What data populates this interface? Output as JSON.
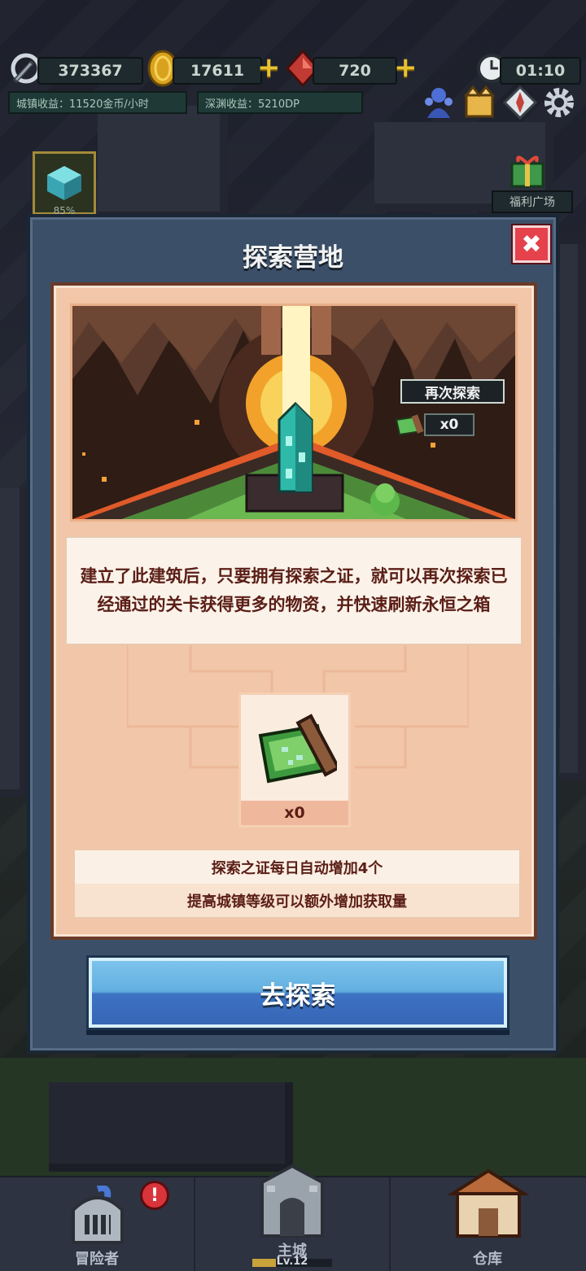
{
  "hud": {
    "power": "373367",
    "gold": "17611",
    "gems": "720",
    "timer": "01:10",
    "town_income": "城镇收益：11520金币/小时",
    "abyss_income": "深渊收益：5210DP",
    "welfare_label": "福利广场",
    "build_progress": "85%"
  },
  "modal": {
    "title": "探索营地",
    "close_glyph": "✖",
    "scene": {
      "reexplore_label": "再次探索",
      "reexplore_count": "x0"
    },
    "description": "建立了此建筑后，只要拥有探索之证，就可以再次探索已经通过的关卡获得更多的物资，并快速刷新永恒之箱",
    "item": {
      "icon": "exploration-pass-scroll-icon",
      "count": "x0"
    },
    "info": [
      "探索之证每日自动增加4个",
      "提高城镇等级可以额外增加获取量"
    ],
    "action_button": "去探索"
  },
  "nav": [
    {
      "label": "冒险者",
      "icon": "knight-helmet-icon",
      "badge": "!"
    },
    {
      "label": "主城",
      "sublabel": "Lv.12",
      "icon": "castle-tower-icon"
    },
    {
      "label": "仓库",
      "icon": "warehouse-icon"
    }
  ],
  "colors": {
    "panel": "#f2c6a8",
    "text_dark_red": "#5a1e16",
    "button_blue": "#62afe0",
    "close_red": "#e5424c",
    "gold": "#e8c230"
  }
}
